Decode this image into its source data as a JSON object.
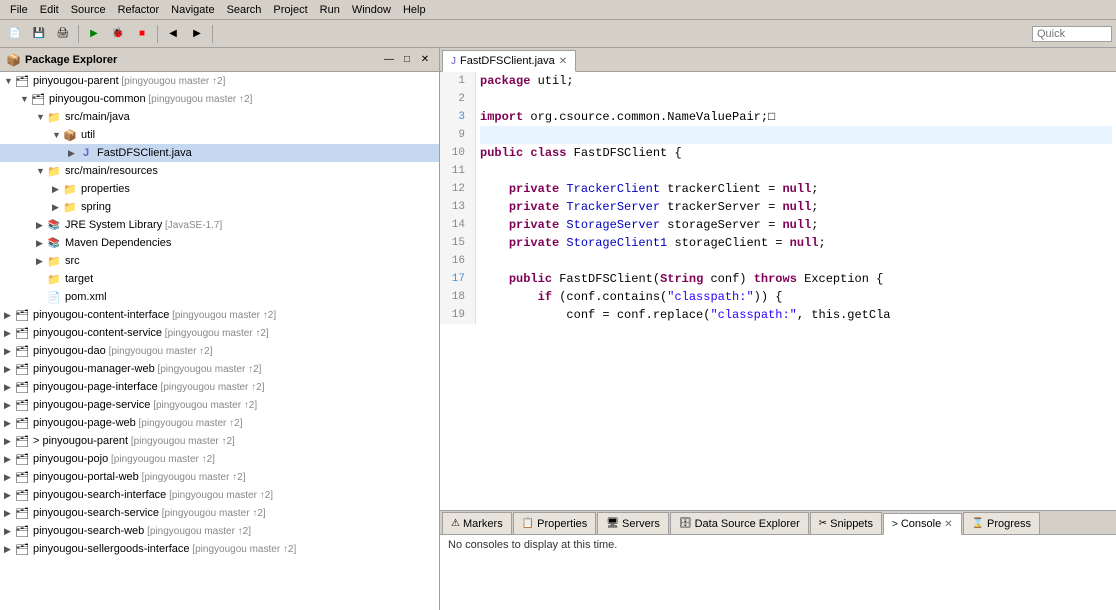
{
  "menubar": {
    "items": [
      "File",
      "Edit",
      "Source",
      "Refactor",
      "Navigate",
      "Search",
      "Project",
      "Run",
      "Window",
      "Help"
    ]
  },
  "toolbar": {
    "search_placeholder": "Quick"
  },
  "left_panel": {
    "title": "Package Explorer",
    "close_icon": "✕",
    "actions": [
      "□",
      "◱",
      "▾",
      "—",
      "□",
      "✕"
    ]
  },
  "tree": {
    "items": [
      {
        "id": "pinyougou-parent",
        "indent": 0,
        "arrow": "▼",
        "icon": "proj",
        "label": "pinyougou-parent",
        "git": "[pingyougou master ↑2]",
        "selected": false
      },
      {
        "id": "pinyougou-common",
        "indent": 1,
        "arrow": "▼",
        "icon": "proj",
        "label": "pinyougou-common",
        "git": "[pingyougou master ↑2]",
        "selected": false
      },
      {
        "id": "src-main-java",
        "indent": 2,
        "arrow": "▼",
        "icon": "folder",
        "label": "src/main/java",
        "git": "",
        "selected": false
      },
      {
        "id": "util-pkg",
        "indent": 3,
        "arrow": "▼",
        "icon": "pkg",
        "label": "util",
        "git": "",
        "selected": false
      },
      {
        "id": "FastDFSClient",
        "indent": 4,
        "arrow": "▶",
        "icon": "java",
        "label": "FastDFSClient.java",
        "git": "",
        "selected": true
      },
      {
        "id": "src-main-resources",
        "indent": 2,
        "arrow": "▼",
        "icon": "folder",
        "label": "src/main/resources",
        "git": "",
        "selected": false
      },
      {
        "id": "properties",
        "indent": 3,
        "arrow": "▶",
        "icon": "folder",
        "label": "properties",
        "git": "",
        "selected": false
      },
      {
        "id": "spring",
        "indent": 3,
        "arrow": "▶",
        "icon": "folder",
        "label": "spring",
        "git": "",
        "selected": false
      },
      {
        "id": "jre",
        "indent": 2,
        "arrow": "▶",
        "icon": "lib",
        "label": "JRE System Library",
        "git": "[JavaSE-1.7]",
        "selected": false
      },
      {
        "id": "maven-dep",
        "indent": 2,
        "arrow": "▶",
        "icon": "lib",
        "label": "Maven Dependencies",
        "git": "",
        "selected": false
      },
      {
        "id": "src",
        "indent": 2,
        "arrow": "▶",
        "icon": "folder",
        "label": "src",
        "git": "",
        "selected": false
      },
      {
        "id": "target",
        "indent": 2,
        "arrow": "",
        "icon": "folder",
        "label": "target",
        "git": "",
        "selected": false
      },
      {
        "id": "pom-xml",
        "indent": 2,
        "arrow": "",
        "icon": "xml",
        "label": "pom.xml",
        "git": "",
        "selected": false
      },
      {
        "id": "pinyougou-content-interface",
        "indent": 0,
        "arrow": "▶",
        "icon": "proj",
        "label": "pinyougou-content-interface",
        "git": "[pingyougou master ↑2]",
        "selected": false
      },
      {
        "id": "pinyougou-content-service",
        "indent": 0,
        "arrow": "▶",
        "icon": "proj",
        "label": "pinyougou-content-service",
        "git": "[pingyougou master ↑2]",
        "selected": false
      },
      {
        "id": "pinyougou-dao",
        "indent": 0,
        "arrow": "▶",
        "icon": "proj",
        "label": "pinyougou-dao",
        "git": "[pingyougou master ↑2]",
        "selected": false
      },
      {
        "id": "pinyougou-manager-web",
        "indent": 0,
        "arrow": "▶",
        "icon": "proj",
        "label": "pinyougou-manager-web",
        "git": "[pingyougou master ↑2]",
        "selected": false
      },
      {
        "id": "pinyougou-page-interface",
        "indent": 0,
        "arrow": "▶",
        "icon": "proj",
        "label": "pinyougou-page-interface",
        "git": "[pingyougou master ↑2]",
        "selected": false
      },
      {
        "id": "pinyougou-page-service",
        "indent": 0,
        "arrow": "▶",
        "icon": "proj",
        "label": "pinyougou-page-service",
        "git": "[pingyougou master ↑2]",
        "selected": false
      },
      {
        "id": "pinyougou-page-web",
        "indent": 0,
        "arrow": "▶",
        "icon": "proj",
        "label": "pinyougou-page-web",
        "git": "[pingyougou master ↑2]",
        "selected": false
      },
      {
        "id": "pinyougou-parent2",
        "indent": 0,
        "arrow": "▶",
        "icon": "proj",
        "label": "> pinyougou-parent",
        "git": "[pingyougou master ↑2]",
        "selected": false
      },
      {
        "id": "pinyougou-pojo",
        "indent": 0,
        "arrow": "▶",
        "icon": "proj",
        "label": "pinyougou-pojo",
        "git": "[pingyougou master ↑2]",
        "selected": false
      },
      {
        "id": "pinyougou-portal-web",
        "indent": 0,
        "arrow": "▶",
        "icon": "proj",
        "label": "pinyougou-portal-web",
        "git": "[pingyougou master ↑2]",
        "selected": false
      },
      {
        "id": "pinyougou-search-interface",
        "indent": 0,
        "arrow": "▶",
        "icon": "proj",
        "label": "pinyougou-search-interface",
        "git": "[pingyougou master ↑2]",
        "selected": false
      },
      {
        "id": "pinyougou-search-service",
        "indent": 0,
        "arrow": "▶",
        "icon": "proj",
        "label": "pinyougou-search-service",
        "git": "[pingyougou master ↑2]",
        "selected": false
      },
      {
        "id": "pinyougou-search-web",
        "indent": 0,
        "arrow": "▶",
        "icon": "proj",
        "label": "pinyougou-search-web",
        "git": "[pingyougou master ↑2]",
        "selected": false
      },
      {
        "id": "pinyougou-sellergoods-interface",
        "indent": 0,
        "arrow": "▶",
        "icon": "proj",
        "label": "pinyougou-sellergoods-interface",
        "git": "[pingyougou master ↑2]",
        "selected": false
      }
    ]
  },
  "editor": {
    "tab_label": "FastDFSClient.java",
    "tab_icon": "java",
    "lines": [
      {
        "num": "1",
        "content": "package util;",
        "tokens": [
          {
            "text": "package ",
            "type": "kw"
          },
          {
            "text": "util;",
            "type": "plain"
          }
        ]
      },
      {
        "num": "2",
        "content": "",
        "tokens": []
      },
      {
        "num": "3",
        "content": "import org.csource.common.NameValuePair;□",
        "tokens": [
          {
            "text": "import ",
            "type": "kw"
          },
          {
            "text": "org.csource.common.NameValuePair;□",
            "type": "plain"
          }
        ],
        "has_marker": true
      },
      {
        "num": "9",
        "content": "",
        "tokens": [],
        "highlighted": true
      },
      {
        "num": "10",
        "content": "public class FastDFSClient {",
        "tokens": [
          {
            "text": "public ",
            "type": "kw"
          },
          {
            "text": "class ",
            "type": "kw"
          },
          {
            "text": "FastDFSClient {",
            "type": "plain"
          }
        ]
      },
      {
        "num": "11",
        "content": "",
        "tokens": []
      },
      {
        "num": "12",
        "content": "    private TrackerClient trackerClient = null;",
        "tokens": [
          {
            "text": "    ",
            "type": "plain"
          },
          {
            "text": "private ",
            "type": "kw"
          },
          {
            "text": "TrackerClient ",
            "type": "type"
          },
          {
            "text": "trackerClient = ",
            "type": "plain"
          },
          {
            "text": "null",
            "type": "kw"
          },
          {
            "text": ";",
            "type": "plain"
          }
        ]
      },
      {
        "num": "13",
        "content": "    private TrackerServer trackerServer = null;",
        "tokens": [
          {
            "text": "    ",
            "type": "plain"
          },
          {
            "text": "private ",
            "type": "kw"
          },
          {
            "text": "TrackerServer ",
            "type": "type"
          },
          {
            "text": "trackerServer = ",
            "type": "plain"
          },
          {
            "text": "null",
            "type": "kw"
          },
          {
            "text": ";",
            "type": "plain"
          }
        ]
      },
      {
        "num": "14",
        "content": "    private StorageServer storageServer = null;",
        "tokens": [
          {
            "text": "    ",
            "type": "plain"
          },
          {
            "text": "private ",
            "type": "kw"
          },
          {
            "text": "StorageServer ",
            "type": "type"
          },
          {
            "text": "storageServer = ",
            "type": "plain"
          },
          {
            "text": "null",
            "type": "kw"
          },
          {
            "text": ";",
            "type": "plain"
          }
        ]
      },
      {
        "num": "15",
        "content": "    private StorageClient1 storageClient = null;",
        "tokens": [
          {
            "text": "    ",
            "type": "plain"
          },
          {
            "text": "private ",
            "type": "kw"
          },
          {
            "text": "StorageClient1 ",
            "type": "type"
          },
          {
            "text": "storageClient = ",
            "type": "plain"
          },
          {
            "text": "null",
            "type": "kw"
          },
          {
            "text": ";",
            "type": "plain"
          }
        ]
      },
      {
        "num": "16",
        "content": "",
        "tokens": []
      },
      {
        "num": "17",
        "content": "    public FastDFSClient(String conf) throws Exception {",
        "tokens": [
          {
            "text": "    ",
            "type": "plain"
          },
          {
            "text": "public ",
            "type": "kw"
          },
          {
            "text": "FastDFSClient(",
            "type": "plain"
          },
          {
            "text": "String ",
            "type": "kw"
          },
          {
            "text": "conf) ",
            "type": "plain"
          },
          {
            "text": "throws ",
            "type": "kw"
          },
          {
            "text": "Exception {",
            "type": "plain"
          }
        ],
        "has_marker": true
      },
      {
        "num": "18",
        "content": "        if (conf.contains(\"classpath:\")) {",
        "tokens": [
          {
            "text": "        ",
            "type": "plain"
          },
          {
            "text": "if ",
            "type": "kw"
          },
          {
            "text": "(conf.contains(",
            "type": "plain"
          },
          {
            "text": "\"classpath:\"",
            "type": "str"
          },
          {
            "text": ")) {",
            "type": "plain"
          }
        ]
      },
      {
        "num": "19",
        "content": "            conf = conf.replace(\"classpath:\", this.getCla",
        "tokens": [
          {
            "text": "            conf = conf.replace(",
            "type": "plain"
          },
          {
            "text": "\"classpath:\"",
            "type": "str"
          },
          {
            "text": ", this.getCla",
            "type": "plain"
          }
        ]
      }
    ]
  },
  "bottom_panel": {
    "tabs": [
      "Markers",
      "Properties",
      "Servers",
      "Data Source Explorer",
      "Snippets",
      "Console",
      "Progress"
    ],
    "active_tab": "Console",
    "content": "No consoles to display at this time."
  }
}
